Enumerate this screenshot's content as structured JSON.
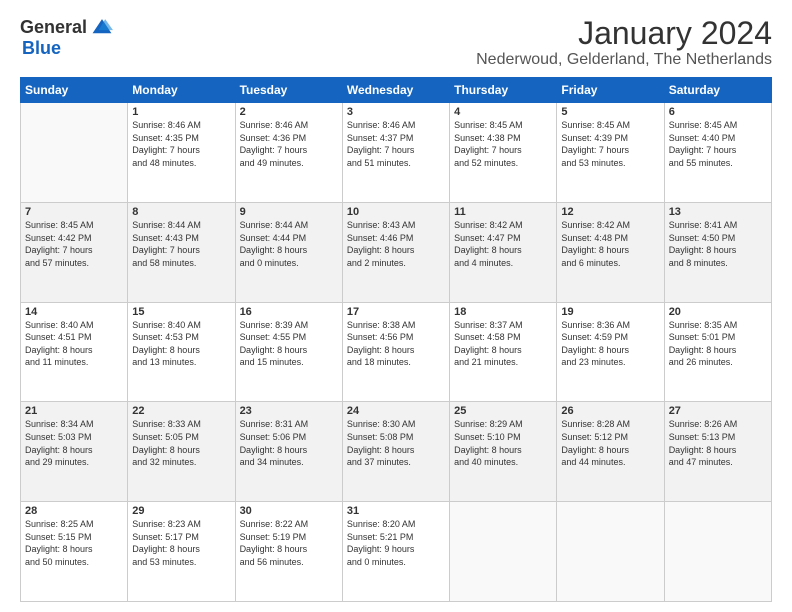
{
  "logo": {
    "general": "General",
    "blue": "Blue"
  },
  "header": {
    "month_year": "January 2024",
    "location": "Nederwoud, Gelderland, The Netherlands"
  },
  "days_of_week": [
    "Sunday",
    "Monday",
    "Tuesday",
    "Wednesday",
    "Thursday",
    "Friday",
    "Saturday"
  ],
  "weeks": [
    [
      {
        "day": "",
        "info": ""
      },
      {
        "day": "1",
        "info": "Sunrise: 8:46 AM\nSunset: 4:35 PM\nDaylight: 7 hours\nand 48 minutes."
      },
      {
        "day": "2",
        "info": "Sunrise: 8:46 AM\nSunset: 4:36 PM\nDaylight: 7 hours\nand 49 minutes."
      },
      {
        "day": "3",
        "info": "Sunrise: 8:46 AM\nSunset: 4:37 PM\nDaylight: 7 hours\nand 51 minutes."
      },
      {
        "day": "4",
        "info": "Sunrise: 8:45 AM\nSunset: 4:38 PM\nDaylight: 7 hours\nand 52 minutes."
      },
      {
        "day": "5",
        "info": "Sunrise: 8:45 AM\nSunset: 4:39 PM\nDaylight: 7 hours\nand 53 minutes."
      },
      {
        "day": "6",
        "info": "Sunrise: 8:45 AM\nSunset: 4:40 PM\nDaylight: 7 hours\nand 55 minutes."
      }
    ],
    [
      {
        "day": "7",
        "info": "Sunrise: 8:45 AM\nSunset: 4:42 PM\nDaylight: 7 hours\nand 57 minutes."
      },
      {
        "day": "8",
        "info": "Sunrise: 8:44 AM\nSunset: 4:43 PM\nDaylight: 7 hours\nand 58 minutes."
      },
      {
        "day": "9",
        "info": "Sunrise: 8:44 AM\nSunset: 4:44 PM\nDaylight: 8 hours\nand 0 minutes."
      },
      {
        "day": "10",
        "info": "Sunrise: 8:43 AM\nSunset: 4:46 PM\nDaylight: 8 hours\nand 2 minutes."
      },
      {
        "day": "11",
        "info": "Sunrise: 8:42 AM\nSunset: 4:47 PM\nDaylight: 8 hours\nand 4 minutes."
      },
      {
        "day": "12",
        "info": "Sunrise: 8:42 AM\nSunset: 4:48 PM\nDaylight: 8 hours\nand 6 minutes."
      },
      {
        "day": "13",
        "info": "Sunrise: 8:41 AM\nSunset: 4:50 PM\nDaylight: 8 hours\nand 8 minutes."
      }
    ],
    [
      {
        "day": "14",
        "info": "Sunrise: 8:40 AM\nSunset: 4:51 PM\nDaylight: 8 hours\nand 11 minutes."
      },
      {
        "day": "15",
        "info": "Sunrise: 8:40 AM\nSunset: 4:53 PM\nDaylight: 8 hours\nand 13 minutes."
      },
      {
        "day": "16",
        "info": "Sunrise: 8:39 AM\nSunset: 4:55 PM\nDaylight: 8 hours\nand 15 minutes."
      },
      {
        "day": "17",
        "info": "Sunrise: 8:38 AM\nSunset: 4:56 PM\nDaylight: 8 hours\nand 18 minutes."
      },
      {
        "day": "18",
        "info": "Sunrise: 8:37 AM\nSunset: 4:58 PM\nDaylight: 8 hours\nand 21 minutes."
      },
      {
        "day": "19",
        "info": "Sunrise: 8:36 AM\nSunset: 4:59 PM\nDaylight: 8 hours\nand 23 minutes."
      },
      {
        "day": "20",
        "info": "Sunrise: 8:35 AM\nSunset: 5:01 PM\nDaylight: 8 hours\nand 26 minutes."
      }
    ],
    [
      {
        "day": "21",
        "info": "Sunrise: 8:34 AM\nSunset: 5:03 PM\nDaylight: 8 hours\nand 29 minutes."
      },
      {
        "day": "22",
        "info": "Sunrise: 8:33 AM\nSunset: 5:05 PM\nDaylight: 8 hours\nand 32 minutes."
      },
      {
        "day": "23",
        "info": "Sunrise: 8:31 AM\nSunset: 5:06 PM\nDaylight: 8 hours\nand 34 minutes."
      },
      {
        "day": "24",
        "info": "Sunrise: 8:30 AM\nSunset: 5:08 PM\nDaylight: 8 hours\nand 37 minutes."
      },
      {
        "day": "25",
        "info": "Sunrise: 8:29 AM\nSunset: 5:10 PM\nDaylight: 8 hours\nand 40 minutes."
      },
      {
        "day": "26",
        "info": "Sunrise: 8:28 AM\nSunset: 5:12 PM\nDaylight: 8 hours\nand 44 minutes."
      },
      {
        "day": "27",
        "info": "Sunrise: 8:26 AM\nSunset: 5:13 PM\nDaylight: 8 hours\nand 47 minutes."
      }
    ],
    [
      {
        "day": "28",
        "info": "Sunrise: 8:25 AM\nSunset: 5:15 PM\nDaylight: 8 hours\nand 50 minutes."
      },
      {
        "day": "29",
        "info": "Sunrise: 8:23 AM\nSunset: 5:17 PM\nDaylight: 8 hours\nand 53 minutes."
      },
      {
        "day": "30",
        "info": "Sunrise: 8:22 AM\nSunset: 5:19 PM\nDaylight: 8 hours\nand 56 minutes."
      },
      {
        "day": "31",
        "info": "Sunrise: 8:20 AM\nSunset: 5:21 PM\nDaylight: 9 hours\nand 0 minutes."
      },
      {
        "day": "",
        "info": ""
      },
      {
        "day": "",
        "info": ""
      },
      {
        "day": "",
        "info": ""
      }
    ]
  ]
}
